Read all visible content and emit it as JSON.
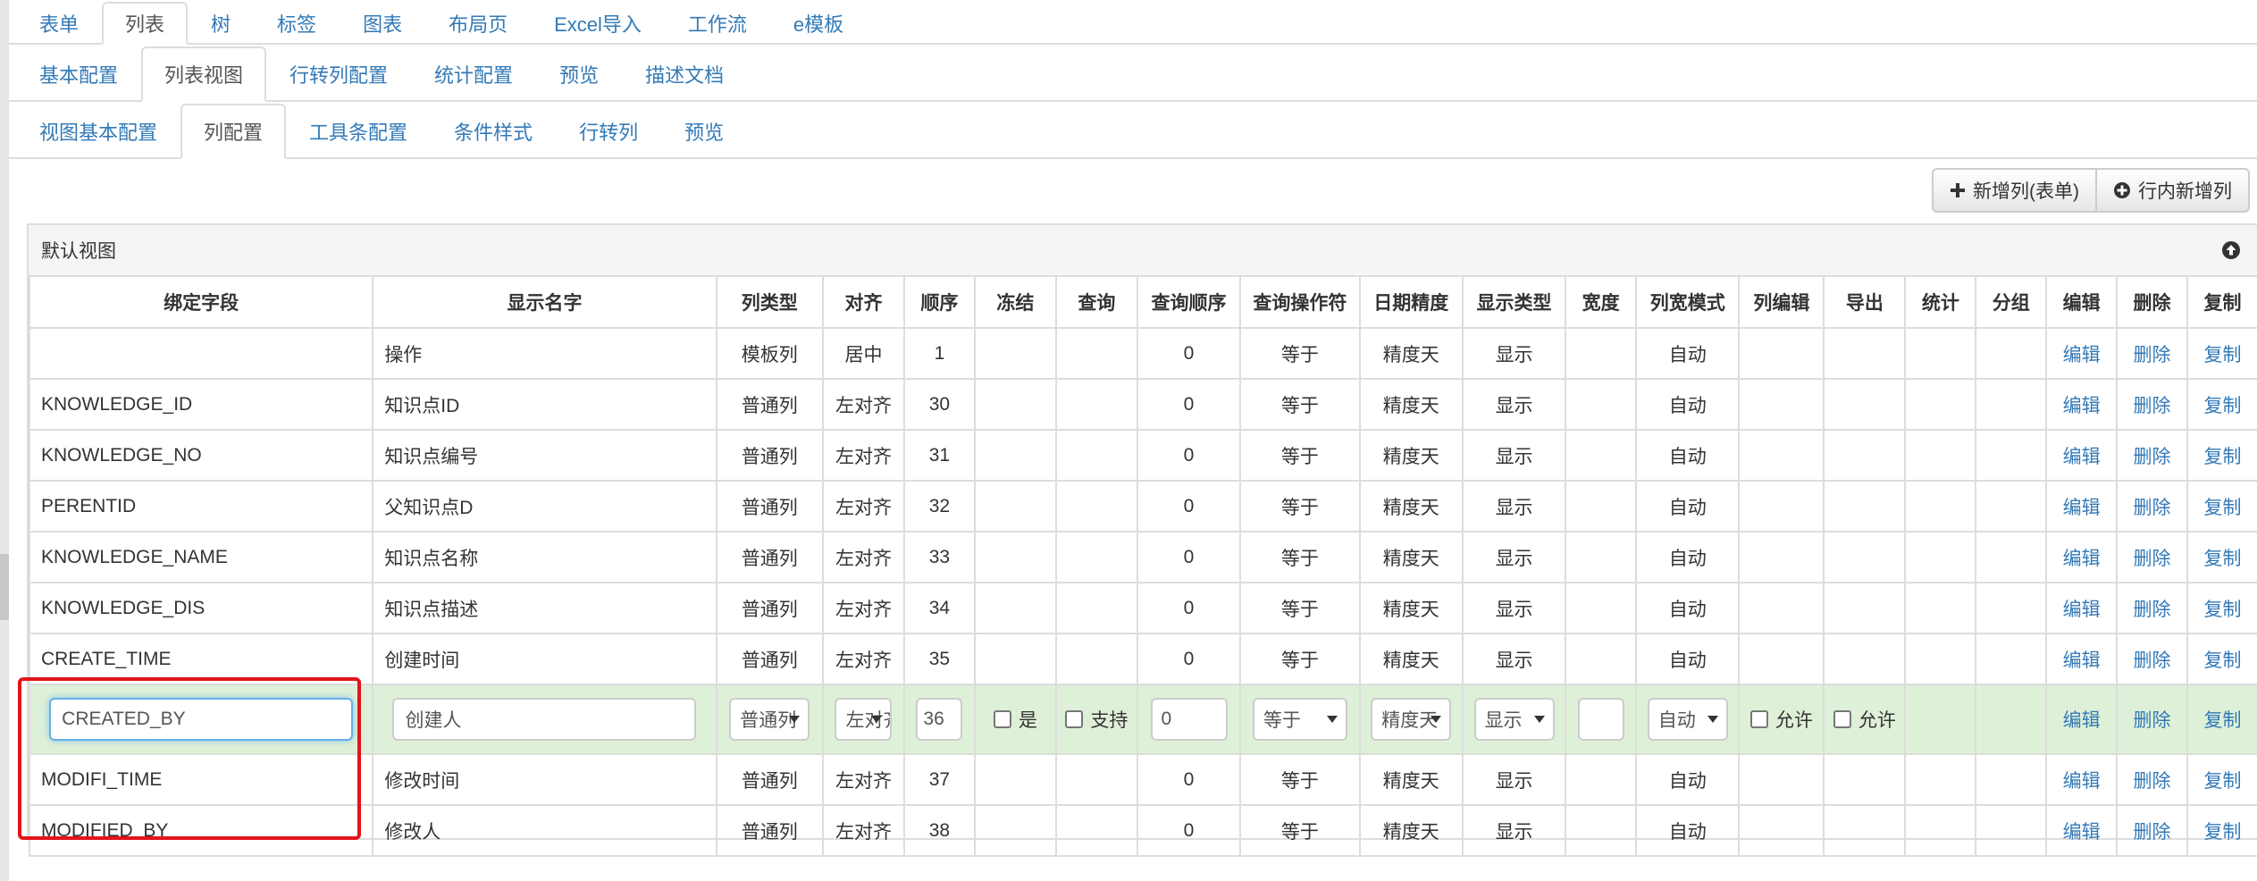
{
  "tabs_l1": [
    "表单",
    "列表",
    "树",
    "标签",
    "图表",
    "布局页",
    "Excel导入",
    "工作流",
    "e模板"
  ],
  "tabs_l2": [
    "基本配置",
    "列表视图",
    "行转列配置",
    "统计配置",
    "预览",
    "描述文档"
  ],
  "tabs_l3": [
    "视图基本配置",
    "列配置",
    "工具条配置",
    "条件样式",
    "行转列",
    "预览"
  ],
  "active": {
    "l1": 1,
    "l2": 1,
    "l3": 1
  },
  "toolbar": {
    "add_form": "新增列(表单)",
    "add_inline": "行内新增列"
  },
  "panel_title": "默认视图",
  "headers": [
    "绑定字段",
    "显示名字",
    "列类型",
    "对齐",
    "顺序",
    "冻结",
    "查询",
    "查询顺序",
    "查询操作符",
    "日期精度",
    "显示类型",
    "宽度",
    "列宽模式",
    "列编辑",
    "导出",
    "统计",
    "分组",
    "编辑",
    "删除",
    "复制"
  ],
  "actions": {
    "edit": "编辑",
    "delete": "删除",
    "copy": "复制"
  },
  "rows": [
    {
      "field": "",
      "name": "操作",
      "type": "模板列",
      "align": "居中",
      "order": "1",
      "qorder": "0",
      "op": "等于",
      "prec": "精度天",
      "disp": "显示",
      "mode": "自动"
    },
    {
      "field": "KNOWLEDGE_ID",
      "name": "知识点ID",
      "type": "普通列",
      "align": "左对齐",
      "order": "30",
      "qorder": "0",
      "op": "等于",
      "prec": "精度天",
      "disp": "显示",
      "mode": "自动"
    },
    {
      "field": "KNOWLEDGE_NO",
      "name": "知识点编号",
      "type": "普通列",
      "align": "左对齐",
      "order": "31",
      "qorder": "0",
      "op": "等于",
      "prec": "精度天",
      "disp": "显示",
      "mode": "自动"
    },
    {
      "field": "PERENTID",
      "name": "父知识点D",
      "type": "普通列",
      "align": "左对齐",
      "order": "32",
      "qorder": "0",
      "op": "等于",
      "prec": "精度天",
      "disp": "显示",
      "mode": "自动"
    },
    {
      "field": "KNOWLEDGE_NAME",
      "name": "知识点名称",
      "type": "普通列",
      "align": "左对齐",
      "order": "33",
      "qorder": "0",
      "op": "等于",
      "prec": "精度天",
      "disp": "显示",
      "mode": "自动"
    },
    {
      "field": "KNOWLEDGE_DIS",
      "name": "知识点描述",
      "type": "普通列",
      "align": "左对齐",
      "order": "34",
      "qorder": "0",
      "op": "等于",
      "prec": "精度天",
      "disp": "显示",
      "mode": "自动"
    },
    {
      "field": "CREATE_TIME",
      "name": "创建时间",
      "type": "普通列",
      "align": "左对齐",
      "order": "35",
      "qorder": "0",
      "op": "等于",
      "prec": "精度天",
      "disp": "显示",
      "mode": "自动"
    }
  ],
  "edit_row": {
    "field": "CREATED_BY",
    "name": "创建人",
    "type": "普通列",
    "align": "左对齐",
    "order": "36",
    "freeze_label": "是",
    "query_label": "支持",
    "qorder": "0",
    "op": "等于",
    "prec": "精度天",
    "disp": "显示",
    "width": "",
    "mode": "自动",
    "colEdit_label": "允许",
    "export_label": "允许"
  },
  "rows_after": [
    {
      "field": "MODIFI_TIME",
      "name": "修改时间",
      "type": "普通列",
      "align": "左对齐",
      "order": "37",
      "qorder": "0",
      "op": "等于",
      "prec": "精度天",
      "disp": "显示",
      "mode": "自动"
    },
    {
      "field": "MODIFIED_BY",
      "name": "修改人",
      "type": "普通列",
      "align": "左对齐",
      "order": "38",
      "qorder": "0",
      "op": "等于",
      "prec": "精度天",
      "disp": "显示",
      "mode": "自动"
    }
  ],
  "colors": {
    "link": "#337ab7",
    "edit_row_bg": "#dff0d8",
    "highlight_border": "#e3141b"
  },
  "icons": {
    "add_form": "plus-icon",
    "add_inline": "plus-circle-icon",
    "panel_toggle": "circle-arrow-up-icon"
  }
}
